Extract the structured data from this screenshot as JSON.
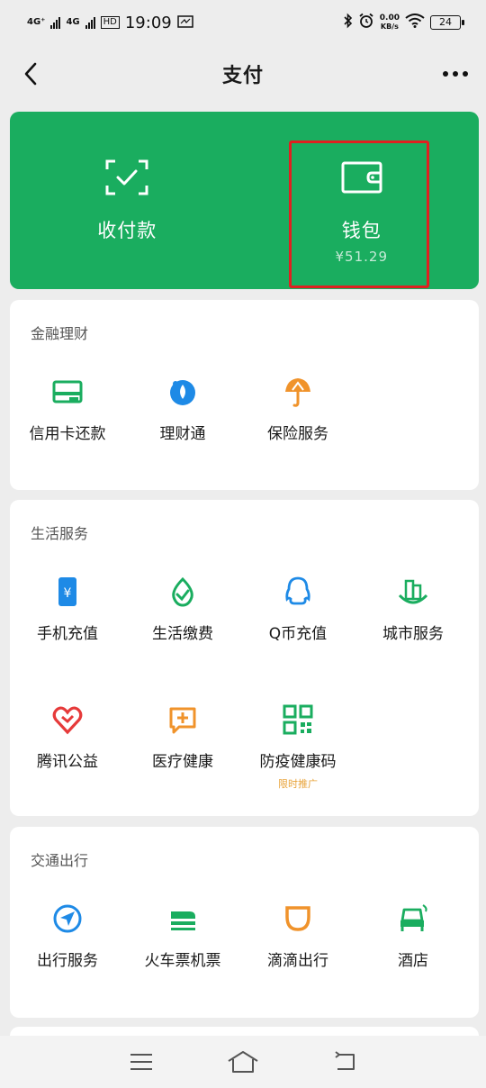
{
  "status_bar": {
    "net1": "4G⁺",
    "net2": "4G",
    "badge": "HD",
    "time": "19:09",
    "speed_value": "0.00",
    "speed_unit": "KB/s",
    "battery": "24"
  },
  "nav": {
    "title": "支付"
  },
  "hero": {
    "collect_label": "收付款",
    "wallet_label": "钱包",
    "wallet_balance": "¥51.29",
    "colors": {
      "background": "#1aad5f",
      "highlight": "#e02020"
    }
  },
  "finance": {
    "title": "金融理财",
    "items": [
      {
        "label": "信用卡还款",
        "icon": "credit-card-icon"
      },
      {
        "label": "理财通",
        "icon": "wealth-icon"
      },
      {
        "label": "保险服务",
        "icon": "insurance-umbrella-icon"
      }
    ]
  },
  "life": {
    "title": "生活服务",
    "items": [
      {
        "label": "手机充值",
        "icon": "phone-recharge-icon"
      },
      {
        "label": "生活缴费",
        "icon": "utility-payment-icon"
      },
      {
        "label": "Q币充值",
        "icon": "qq-penguin-icon"
      },
      {
        "label": "城市服务",
        "icon": "city-service-icon"
      },
      {
        "label": "腾讯公益",
        "icon": "charity-heart-icon"
      },
      {
        "label": "医疗健康",
        "icon": "medical-icon"
      },
      {
        "label": "防疫健康码",
        "icon": "qr-code-icon",
        "note": "限时推广"
      }
    ]
  },
  "travel": {
    "title": "交通出行",
    "items": [
      {
        "label": "出行服务",
        "icon": "travel-compass-icon"
      },
      {
        "label": "火车票机票",
        "icon": "train-icon"
      },
      {
        "label": "滴滴出行",
        "icon": "didi-icon"
      },
      {
        "label": "酒店",
        "icon": "hotel-bed-icon"
      }
    ]
  },
  "icon_colors": {
    "green": "#1aad5f",
    "blue": "#1e8ae6",
    "orange": "#f0932b",
    "red": "#e63a3a"
  }
}
